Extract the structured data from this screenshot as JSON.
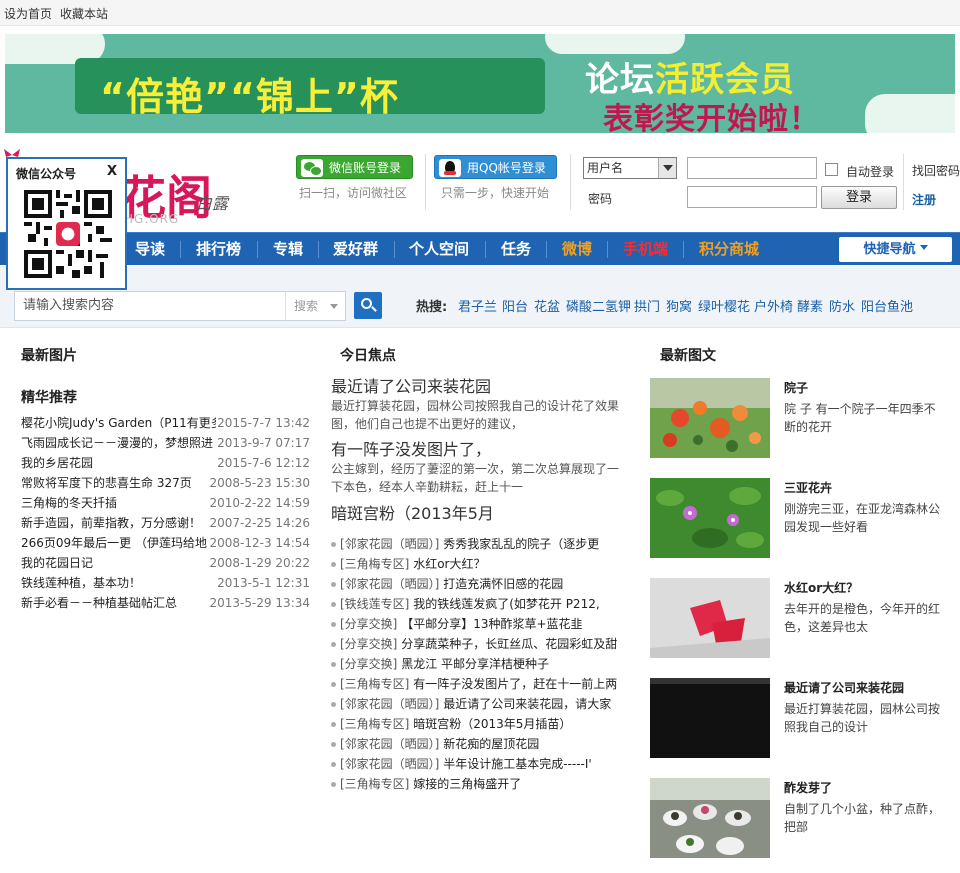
{
  "topbar": {
    "set_home": "设为首页",
    "bookmark": "收藏本站"
  },
  "banner": {
    "title_left": "“倍艳”“锦上”杯",
    "title_right_1": "论坛",
    "title_right_2": "活跃会员",
    "title_right_3": "表彰奖",
    "title_right_4": "开始啦！"
  },
  "logo": {
    "name": "花阁",
    "signature": "白露",
    "domain": "HG.ORG"
  },
  "qr_popup": {
    "title": "微信公众号",
    "close": "X"
  },
  "login": {
    "wechat_btn": "微信账号登录",
    "wechat_tip": "扫一扫，访问微社区",
    "qq_btn": "用QQ帐号登录",
    "qq_tip": "只需一步，快速开始",
    "username_option": "用户名",
    "password_label": "密码",
    "auto_login": "自动登录",
    "submit": "登录",
    "forgot": "找回密码",
    "register": "注册"
  },
  "nav": {
    "items": [
      "导读",
      "排行榜",
      "专辑",
      "爱好群",
      "个人空间",
      "任务"
    ],
    "weibo": "微博",
    "mobile": "手机端",
    "points_mall": "积分商城",
    "quick": "快捷导航"
  },
  "search": {
    "placeholder": "请输入搜索内容",
    "scope": "搜索",
    "hot_label": "热搜:",
    "hot": [
      "君子兰",
      "阳台",
      "花盆",
      "磷酸二氢钾",
      "拱门",
      "狗窝",
      "绿叶樱花",
      "户外椅",
      "酵素",
      "防水",
      "阳台鱼池"
    ]
  },
  "left": {
    "latest_images_title": "最新图片",
    "featured_title": "精华推荐",
    "featured": [
      {
        "title": "樱花小院Judy's Garden（P11有更多",
        "date": "2015-7-7 13:42"
      },
      {
        "title": "飞雨园成长记－－漫漫的，梦想照进",
        "date": "2013-9-7 07:17"
      },
      {
        "title": "我的乡居花园",
        "date": "2015-7-6 12:12"
      },
      {
        "title": "常败将军度下的悲喜生命 327页",
        "date": "2008-5-23 15:30"
      },
      {
        "title": "三角梅的冬天扦插",
        "date": "2010-2-22 14:59"
      },
      {
        "title": "新手造园，前辈指教，万分感谢！",
        "date": "2007-2-25 14:26"
      },
      {
        "title": "266页09年最后一更 （伊莲玛给地",
        "date": "2008-12-3 14:54"
      },
      {
        "title": "我的花园日记",
        "date": "2008-1-29 20:22"
      },
      {
        "title": "铁线莲种植，基本功！",
        "date": "2013-5-1 12:31"
      },
      {
        "title": "新手必看－－种植基础帖汇总",
        "date": "2013-5-29 13:34"
      }
    ]
  },
  "middle": {
    "title": "今日焦点",
    "focus": [
      {
        "title": "最近请了公司来装花园",
        "desc": "最近打算装花园，园林公司按照我自己的设计花了效果图，他们自己也提不出更好的建议，"
      },
      {
        "title": "有一阵子没发图片了，",
        "desc": "公主嫁到，经历了萋涩的第一次，第二次总算展现了一下本色，经本人辛勤耕耘，赶上十一"
      },
      {
        "title": "暗斑宫粉（2013年5月",
        "desc": ""
      }
    ],
    "threads": [
      {
        "cat": "[邻家花园（晒园）]",
        "title": "秀秀我家乱乱的院子（逐步更"
      },
      {
        "cat": "[三角梅专区]",
        "title": "水红or大红？"
      },
      {
        "cat": "[邻家花园（晒园）]",
        "title": "打造充满怀旧感的花园"
      },
      {
        "cat": "[铁线莲专区]",
        "title": "我的铁线莲发疯了(如梦花开 P212,"
      },
      {
        "cat": "[分享交换]",
        "title": "【平邮分享】13种酢浆草+蓝花韭"
      },
      {
        "cat": "[分享交换]",
        "title": "分享蔬菜种子，长豇丝瓜、花园彩虹及甜"
      },
      {
        "cat": "[分享交换]",
        "title": "黑龙江 平邮分享洋桔梗种子"
      },
      {
        "cat": "[三角梅专区]",
        "title": "有一阵子没发图片了，赶在十一前上两"
      },
      {
        "cat": "[邻家花园（晒园）]",
        "title": "最近请了公司来装花园，请大家"
      },
      {
        "cat": "[三角梅专区]",
        "title": "暗斑宫粉（2013年5月插苗）"
      },
      {
        "cat": "[邻家花园（晒园）]",
        "title": "新花痴的屋顶花园"
      },
      {
        "cat": "[邻家花园（晒园）]",
        "title": "半年设计施工基本完成-----I'"
      },
      {
        "cat": "[三角梅专区]",
        "title": "嫁接的三角梅盛开了"
      }
    ]
  },
  "right": {
    "title": "最新图文",
    "cards": [
      {
        "title": "院子",
        "desc": "院 子 有一个院子一年四季不断的花开"
      },
      {
        "title": "三亚花卉",
        "desc": "刚游完三亚，在亚龙湾森林公园发现一些好看"
      },
      {
        "title": "水红or大红？",
        "desc": "去年开的是橙色，今年开的红色，这差异也太"
      },
      {
        "title": "最近请了公司来装花园",
        "desc": "最近打算装花园，园林公司按照我自己的设计"
      },
      {
        "title": "酢发芽了",
        "desc": "自制了几个小盆，种了点酢，把部"
      }
    ]
  },
  "colors": {
    "nav_blue": "#1f63b3",
    "brand_red": "#d8175a",
    "weibo_orange": "#f0a020",
    "mobile_red": "#ff2a2a",
    "link_blue": "#1a5fa8"
  }
}
